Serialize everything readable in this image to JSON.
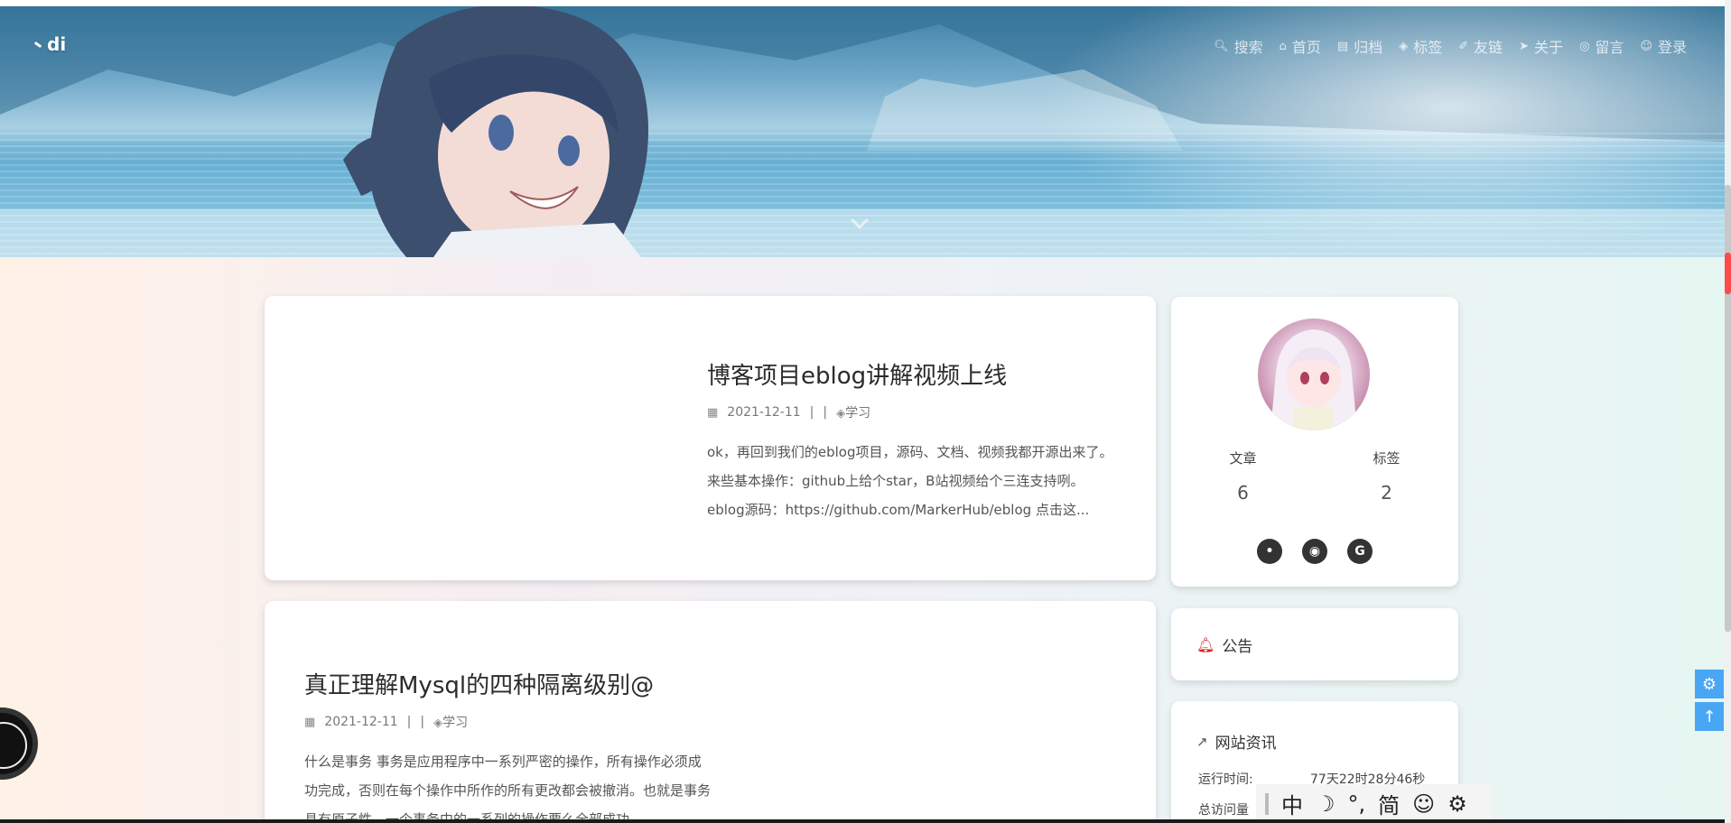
{
  "header": {
    "logo_text": "di",
    "nav": [
      {
        "label": "搜索",
        "icon": "search-icon"
      },
      {
        "label": "首页",
        "icon": "home-icon"
      },
      {
        "label": "归档",
        "icon": "archive-icon"
      },
      {
        "label": "标签",
        "icon": "tag-icon"
      },
      {
        "label": "友链",
        "icon": "link-icon"
      },
      {
        "label": "关于",
        "icon": "paper-plane-icon"
      },
      {
        "label": "留言",
        "icon": "comment-icon"
      },
      {
        "label": "登录",
        "icon": "user-icon"
      }
    ]
  },
  "posts": [
    {
      "title": "博客项目eblog讲解视频上线",
      "date": "2021-12-11",
      "separator": "|",
      "tag": "学习",
      "excerpt": "ok，再回到我们的eblog项目，源码、文档、视频我都开源出来了。来些基本操作：github上给个star，B站视频给个三连支持咧。eblog源码：https://github.com/MarkerHub/eblog 点击这..."
    },
    {
      "title": "真正理解Mysql的四种隔离级别@",
      "date": "2021-12-11",
      "separator": "|",
      "tag": "学习",
      "excerpt": "什么是事务 事务是应用程序中一系列严密的操作，所有操作必须成功完成，否则在每个操作中所作的所有更改都会被撤消。也就是事务具有原子性，一个事务中的一系列的操作要么全部成功，..."
    }
  ],
  "profile": {
    "stats": [
      {
        "label": "文章",
        "value": "6"
      },
      {
        "label": "标签",
        "value": "2"
      }
    ],
    "socials": [
      "qq-icon",
      "github-icon",
      "gitee-icon"
    ]
  },
  "notice": {
    "title": "公告"
  },
  "site_info": {
    "title": "网站资讯",
    "runtime_label": "运行时间:",
    "runtime_value": "77天22时28分46秒",
    "visits_label": "总访问量"
  },
  "ime": {
    "mode": "中",
    "theme": "☽",
    "punct": "°,",
    "charset": "简",
    "emoji": "☺",
    "settings": "⚙"
  },
  "colors": {
    "accent": "#49a6f5",
    "bell": "#e02020",
    "scroll_marker": "#ff4a4a"
  }
}
